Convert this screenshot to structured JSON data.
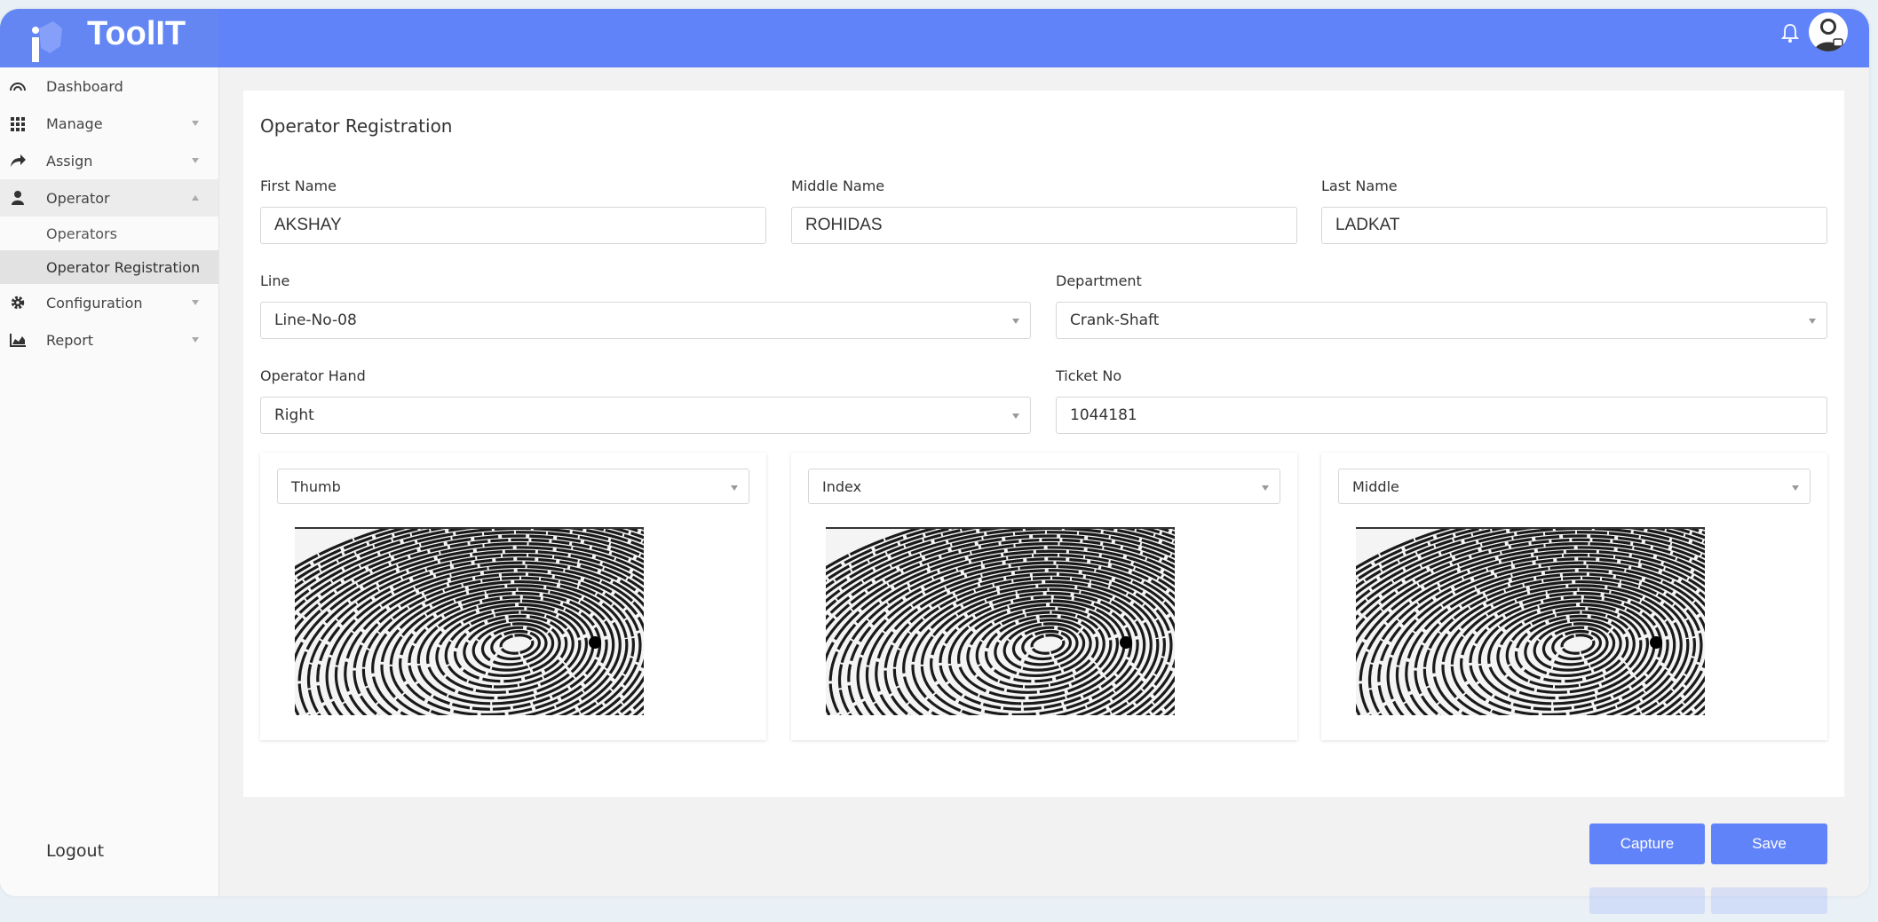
{
  "app": {
    "title": "ToolIT"
  },
  "colors": {
    "accent": "#6183f9",
    "header": "#6183f9"
  },
  "header": {
    "icons": [
      "bell-icon",
      "avatar-icon"
    ]
  },
  "sidebar": {
    "items": [
      {
        "label": "Dashboard",
        "icon": "dashboard-icon"
      },
      {
        "label": "Manage",
        "icon": "grid-icon"
      },
      {
        "label": "Assign",
        "icon": "share-arrow-icon"
      },
      {
        "label": "Operator",
        "icon": "user-icon"
      },
      {
        "label": "Configuration",
        "icon": "gear-icon"
      },
      {
        "label": "Report",
        "icon": "area-chart-icon"
      }
    ],
    "sub_items": [
      "Operators",
      "Operator Registration"
    ],
    "logout": "Logout"
  },
  "form": {
    "title": "Operator Registration",
    "first_name": {
      "label": "First Name",
      "value": "AKSHAY"
    },
    "middle_name": {
      "label": "Middle Name",
      "value": "ROHIDAS"
    },
    "last_name": {
      "label": "Last Name",
      "value": "LADKAT"
    },
    "line": {
      "label": "Line",
      "value": "Line-No-08"
    },
    "department": {
      "label": "Department",
      "value": "Crank-Shaft"
    },
    "operator_hand": {
      "label": "Operator Hand",
      "value": "Right"
    },
    "ticket_no": {
      "label": "Ticket No",
      "value": "1044181"
    }
  },
  "fingers": [
    {
      "selected": "Thumb"
    },
    {
      "selected": "Index"
    },
    {
      "selected": "Middle"
    }
  ],
  "buttons": {
    "capture": "Capture",
    "save": "Save"
  }
}
